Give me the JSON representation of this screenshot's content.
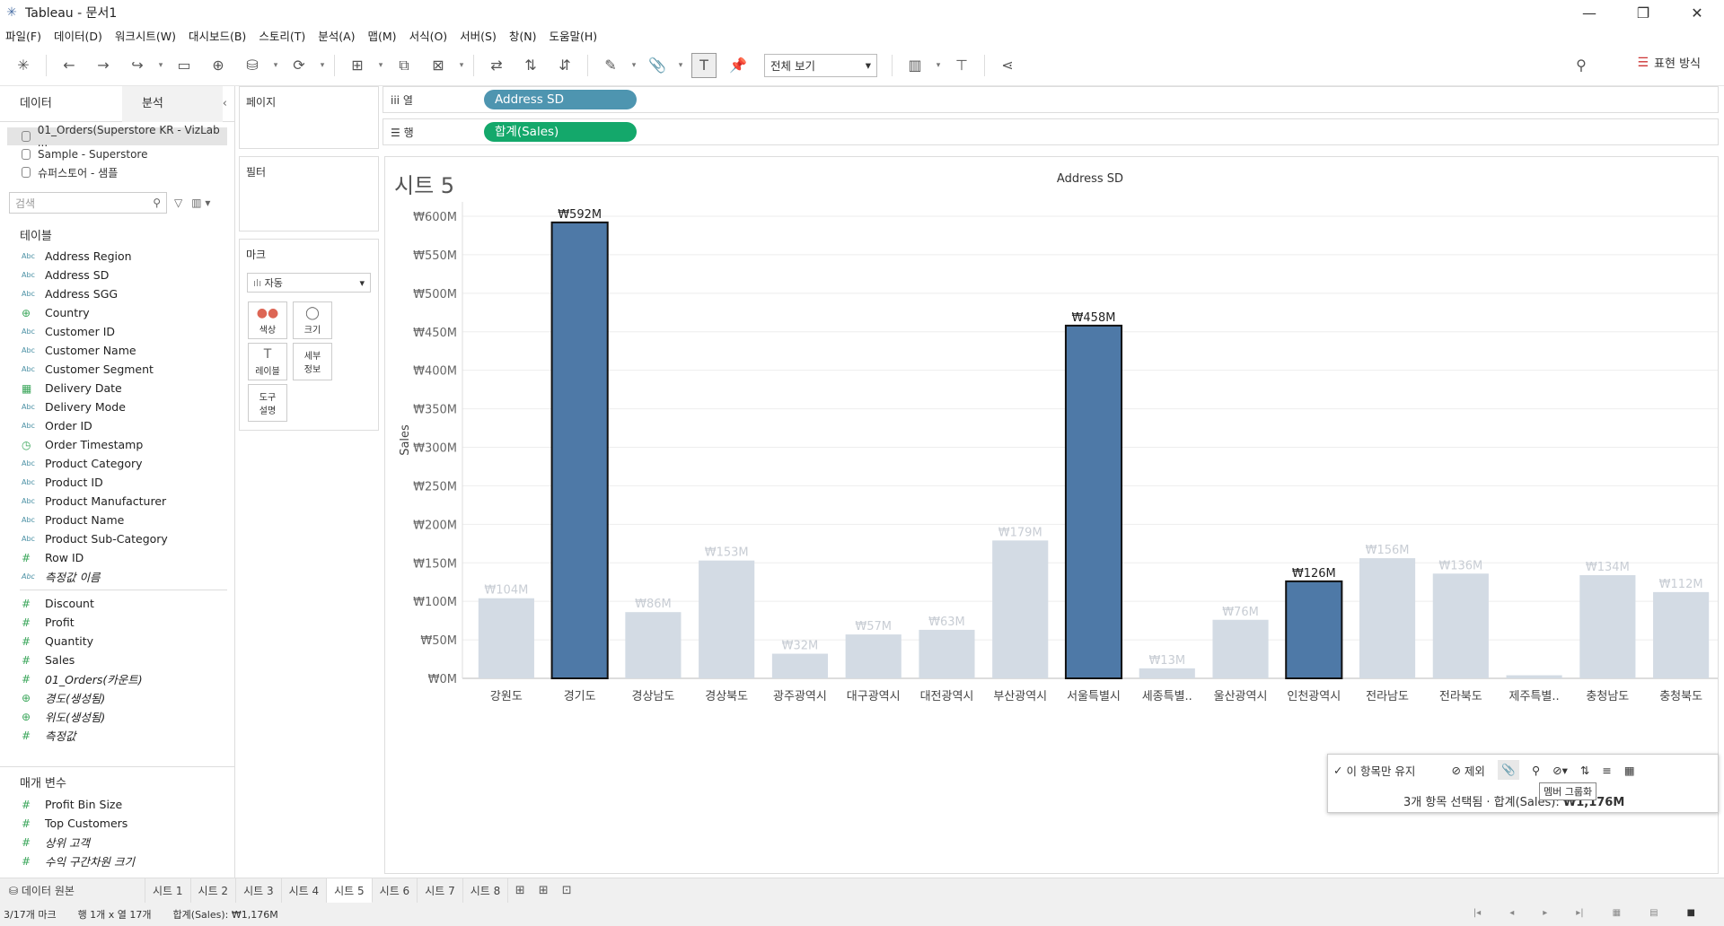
{
  "window": {
    "title": "Tableau - 문서1",
    "min": "—",
    "restore": "❐",
    "close": "✕"
  },
  "menu": [
    "파일(F)",
    "데이터(D)",
    "워크시트(W)",
    "대시보드(B)",
    "스토리(T)",
    "분석(A)",
    "맵(M)",
    "서식(O)",
    "서버(S)",
    "창(N)",
    "도움말(H)"
  ],
  "toolbar": {
    "view_select": "전체 보기",
    "show_me": "표현 방식"
  },
  "data_pane": {
    "tab_data": "데이터",
    "tab_analysis": "분석",
    "datasources": [
      "01_Orders(Superstore KR - VizLab ...",
      "Sample - Superstore",
      "슈퍼스토어 - 샘플"
    ],
    "search_placeholder": "검색",
    "tables_header": "테이블",
    "dimensions": [
      {
        "type": "Abc",
        "name": "Address Region"
      },
      {
        "type": "Abc",
        "name": "Address SD"
      },
      {
        "type": "Abc",
        "name": "Address SGG"
      },
      {
        "type": "geo",
        "name": "Country"
      },
      {
        "type": "Abc",
        "name": "Customer ID"
      },
      {
        "type": "Abc",
        "name": "Customer Name"
      },
      {
        "type": "Abc",
        "name": "Customer Segment"
      },
      {
        "type": "date",
        "name": "Delivery Date"
      },
      {
        "type": "Abc",
        "name": "Delivery Mode"
      },
      {
        "type": "Abc",
        "name": "Order ID"
      },
      {
        "type": "datetime",
        "name": "Order Timestamp"
      },
      {
        "type": "Abc",
        "name": "Product Category"
      },
      {
        "type": "Abc",
        "name": "Product ID"
      },
      {
        "type": "Abc",
        "name": "Product Manufacturer"
      },
      {
        "type": "Abc",
        "name": "Product Name"
      },
      {
        "type": "Abc",
        "name": "Product Sub-Category"
      },
      {
        "type": "#",
        "name": "Row ID"
      },
      {
        "type": "Abc",
        "name": "측정값 이름"
      }
    ],
    "measures": [
      {
        "type": "#",
        "name": "Discount"
      },
      {
        "type": "#",
        "name": "Profit"
      },
      {
        "type": "#",
        "name": "Quantity"
      },
      {
        "type": "#",
        "name": "Sales"
      },
      {
        "type": "#",
        "name": "01_Orders(카운트)"
      },
      {
        "type": "geo",
        "name": "경도(생성됨)"
      },
      {
        "type": "geo",
        "name": "위도(생성됨)"
      },
      {
        "type": "#",
        "name": "측정값"
      }
    ],
    "params_header": "매개 변수",
    "params": [
      {
        "type": "#",
        "name": "Profit Bin Size"
      },
      {
        "type": "#",
        "name": "Top Customers"
      },
      {
        "type": "#",
        "name": "상위 고객"
      },
      {
        "type": "#",
        "name": "수익 구간차원 크기"
      }
    ]
  },
  "shelves": {
    "pages": "페이지",
    "filters": "필터",
    "marks": "마크",
    "mark_type": "자동",
    "mark_buttons": [
      {
        "icon": "●●",
        "label": "색상"
      },
      {
        "icon": "◯",
        "label": "크기"
      },
      {
        "icon": "T",
        "label": "레이블"
      },
      {
        "icon": "",
        "label": "세부\n정보"
      },
      {
        "icon": "",
        "label": "도구\n설명"
      }
    ],
    "columns_label": "열",
    "rows_label": "행",
    "columns_pill": "Address SD",
    "rows_pill": "합계(Sales)"
  },
  "sheet": {
    "title": "시트 5"
  },
  "chart_data": {
    "type": "bar",
    "title": "Address SD",
    "xlabel": "",
    "ylabel": "Sales",
    "ylim": [
      0,
      630
    ],
    "yticks": [
      "₩0M",
      "₩50M",
      "₩100M",
      "₩150M",
      "₩200M",
      "₩250M",
      "₩300M",
      "₩350M",
      "₩400M",
      "₩450M",
      "₩500M",
      "₩550M",
      "₩600M"
    ],
    "ytick_values": [
      0,
      50,
      100,
      150,
      200,
      250,
      300,
      350,
      400,
      450,
      500,
      550,
      600
    ],
    "categories": [
      "강원도",
      "경기도",
      "경상남도",
      "경상북도",
      "광주광역시",
      "대구광역시",
      "대전광역시",
      "부산광역시",
      "서울특별시",
      "세종특별..",
      "울산광역시",
      "인천광역시",
      "전라남도",
      "전라북도",
      "제주특별..",
      "충청남도",
      "충청북도"
    ],
    "values": [
      104,
      592,
      86,
      153,
      32,
      57,
      63,
      179,
      458,
      13,
      76,
      126,
      156,
      136,
      4,
      134,
      112
    ],
    "labels": [
      "₩104M",
      "₩592M",
      "₩86M",
      "₩153M",
      "₩32M",
      "₩57M",
      "₩63M",
      "₩179M",
      "₩458M",
      "₩13M",
      "₩76M",
      "₩126M",
      "₩156M",
      "₩136M",
      "",
      "₩134M",
      "₩112M"
    ],
    "selected": [
      false,
      true,
      false,
      false,
      false,
      false,
      false,
      false,
      true,
      false,
      false,
      true,
      false,
      false,
      false,
      false,
      false
    ],
    "colors": {
      "selected": "#4e79a7",
      "dimmed": "#d3dbe4",
      "label_dim": "#c8cdd4",
      "label_sel": "#222222"
    }
  },
  "tooltip": {
    "keep_only": "이 항목만 유지",
    "exclude": "제외",
    "group_tip": "멤버 그룹화",
    "summary_prefix": "3개 항목 선택됨 · 합계(Sales): ",
    "summary_value": "₩1,176M"
  },
  "tabs": {
    "datasource": "데이터 원본",
    "sheets": [
      "시트 1",
      "시트 2",
      "시트 3",
      "시트 4",
      "시트 5",
      "시트 6",
      "시트 7",
      "시트 8"
    ],
    "active": "시트 5"
  },
  "status": {
    "marks": "3/17개 마크",
    "dims": "행 1개 x 열 17개",
    "sum": "합계(Sales): ₩1,176M"
  }
}
